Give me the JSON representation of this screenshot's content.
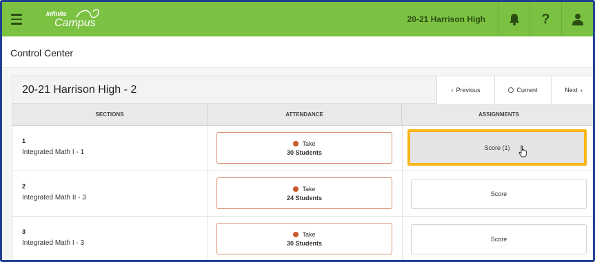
{
  "header": {
    "logo_line1": "Infinite",
    "logo_line2": "Campus",
    "school": "20-21 Harrison High",
    "icons": [
      "menu-icon",
      "bell-icon",
      "help-icon",
      "user-icon"
    ],
    "help_glyph": "?"
  },
  "page": {
    "title": "Control Center"
  },
  "card": {
    "title": "20-21 Harrison High - 2",
    "nav": {
      "previous": "Previous",
      "current": "Current",
      "next": "Next"
    },
    "columns": {
      "sections": "SECTIONS",
      "attendance": "ATTENDANCE",
      "assignments": "ASSIGNMENTS"
    },
    "rows": [
      {
        "number": "1",
        "name": "Integrated Math I - 1",
        "take": "Take",
        "students": "30 Students",
        "score": "Score (1)"
      },
      {
        "number": "2",
        "name": "Integrated Math II - 3",
        "take": "Take",
        "students": "24 Students",
        "score": "Score"
      },
      {
        "number": "3",
        "name": "Integrated Math I - 3",
        "take": "Take",
        "students": "30 Students",
        "score": "Score"
      }
    ]
  },
  "colors": {
    "topbar": "#7cc242",
    "highlight": "#f8b619",
    "attendance_dot": "#c85a2c",
    "frame": "#1f3f8f"
  }
}
